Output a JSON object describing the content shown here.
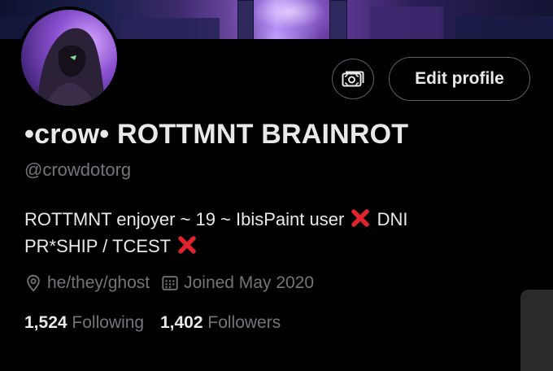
{
  "profile": {
    "display_name": "•crow• ROTTMNT BRAINROT",
    "handle": "@crowdotorg",
    "bio_line1": "ROTTMNT enjoyer ~ 19 ~ IbisPaint user",
    "bio_line1_tail": "DNI",
    "bio_line2": "PR*SHIP / TCEST",
    "pronouns": "he/they/ghost",
    "joined": "Joined May 2020",
    "following_count": "1,524",
    "following_label": "Following",
    "followers_count": "1,402",
    "followers_label": "Followers"
  },
  "buttons": {
    "edit_profile": "Edit profile",
    "tip_icon": "money-icon"
  },
  "icons": {
    "location": "location-pin-icon",
    "calendar": "calendar-icon",
    "cross_mark": "red-cross-emoji"
  },
  "colors": {
    "background": "#000000",
    "text_primary": "#e7e9ea",
    "text_secondary": "#71767b",
    "border": "#536471",
    "cross_red": "#e0242e"
  }
}
